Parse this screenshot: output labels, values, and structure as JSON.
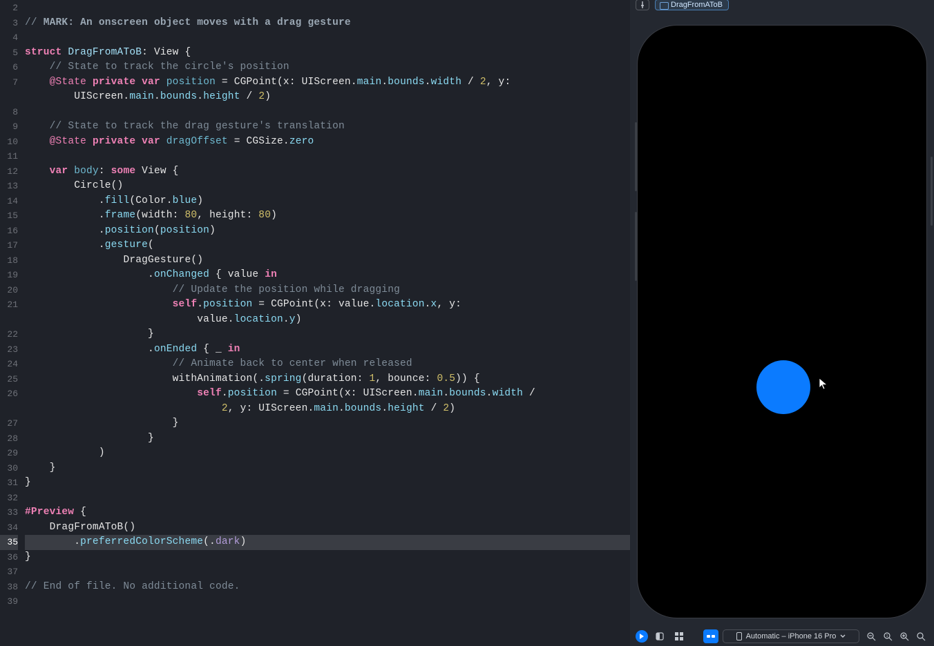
{
  "preview": {
    "breadcrumb_label": "DragFromAToB",
    "device_selector": "Automatic – iPhone 16 Pro"
  },
  "editor": {
    "active_line": 35,
    "lines": [
      {
        "n": 2,
        "html": ""
      },
      {
        "n": 3,
        "html": "<span class='cmt'>// </span><span class='cmt-bold'>MARK: An onscreen object moves with a drag gesture</span>"
      },
      {
        "n": 4,
        "html": ""
      },
      {
        "n": 5,
        "html": "<span class='kw-pink'>struct</span> <span class='type-blue'>DragFromAToB</span><span class='white'>: View {</span>"
      },
      {
        "n": 6,
        "html": "    <span class='cmt'>// State to track the circle's position</span>"
      },
      {
        "n": 7,
        "html": "    <span class='kw-pink2'>@State</span> <span class='kw-pink'>private</span> <span class='kw-pink'>var</span> <span class='identifier'>position</span> <span class='white'>= CGPoint(x: UIScreen.</span><span class='prop'>main</span><span class='white'>.</span><span class='prop'>bounds</span><span class='white'>.</span><span class='prop'>width</span> <span class='white'>/</span> <span class='num'>2</span><span class='white'>, y:</span>"
      },
      {
        "n": "",
        "html": "        <span class='white'>UIScreen.</span><span class='prop'>main</span><span class='white'>.</span><span class='prop'>bounds</span><span class='white'>.</span><span class='prop'>height</span> <span class='white'>/</span> <span class='num'>2</span><span class='white'>)</span>"
      },
      {
        "n": 8,
        "html": ""
      },
      {
        "n": 9,
        "html": "    <span class='cmt'>// State to track the drag gesture's translation</span>"
      },
      {
        "n": 10,
        "html": "    <span class='kw-pink2'>@State</span> <span class='kw-pink'>private</span> <span class='kw-pink'>var</span> <span class='identifier'>dragOffset</span> <span class='white'>= CGSize.</span><span class='prop'>zero</span>"
      },
      {
        "n": 11,
        "html": ""
      },
      {
        "n": 12,
        "html": "    <span class='kw-pink'>var</span> <span class='identifier'>body</span><span class='white'>:</span> <span class='kw-pink'>some</span> <span class='white'>View {</span>"
      },
      {
        "n": 13,
        "html": "        <span class='white'>Circle()</span>"
      },
      {
        "n": 14,
        "html": "            <span class='white'>.</span><span class='call'>fill</span><span class='white'>(Color.</span><span class='prop'>blue</span><span class='white'>)</span>"
      },
      {
        "n": 15,
        "html": "            <span class='white'>.</span><span class='call'>frame</span><span class='white'>(width: </span><span class='num'>80</span><span class='white'>, height: </span><span class='num'>80</span><span class='white'>)</span>"
      },
      {
        "n": 16,
        "html": "            <span class='white'>.</span><span class='call'>position</span><span class='white'>(</span><span class='prop'>position</span><span class='white'>)</span>"
      },
      {
        "n": 17,
        "html": "            <span class='white'>.</span><span class='call'>gesture</span><span class='white'>(</span>"
      },
      {
        "n": 18,
        "html": "                <span class='white'>DragGesture()</span>"
      },
      {
        "n": 19,
        "html": "                    <span class='white'>.</span><span class='call'>onChanged</span> <span class='white'>{ value </span><span class='kw-pink'>in</span>"
      },
      {
        "n": 20,
        "html": "                        <span class='cmt'>// Update the position while dragging</span>"
      },
      {
        "n": 21,
        "html": "                        <span class='kw-pink'>self</span><span class='white'>.</span><span class='prop'>position</span> <span class='white'>= CGPoint(x: value.</span><span class='prop'>location</span><span class='white'>.</span><span class='prop'>x</span><span class='white'>, y:</span>"
      },
      {
        "n": "",
        "html": "                            <span class='white'>value.</span><span class='prop'>location</span><span class='white'>.</span><span class='prop'>y</span><span class='white'>)</span>"
      },
      {
        "n": 22,
        "html": "                    <span class='white'>}</span>"
      },
      {
        "n": 23,
        "html": "                    <span class='white'>.</span><span class='call'>onEnded</span> <span class='white'>{ _ </span><span class='kw-pink'>in</span>"
      },
      {
        "n": 24,
        "html": "                        <span class='cmt'>// Animate back to center when released</span>"
      },
      {
        "n": 25,
        "html": "                        <span class='white'>withAnimation(.</span><span class='call'>spring</span><span class='white'>(duration: </span><span class='num'>1</span><span class='white'>, bounce: </span><span class='num'>0.5</span><span class='white'>)) {</span>"
      },
      {
        "n": 26,
        "html": "                            <span class='kw-pink'>self</span><span class='white'>.</span><span class='prop'>position</span> <span class='white'>= CGPoint(x: UIScreen.</span><span class='prop'>main</span><span class='white'>.</span><span class='prop'>bounds</span><span class='white'>.</span><span class='prop'>width</span> <span class='white'>/</span>"
      },
      {
        "n": "",
        "html": "                                <span class='num'>2</span><span class='white'>, y: UIScreen.</span><span class='prop'>main</span><span class='white'>.</span><span class='prop'>bounds</span><span class='white'>.</span><span class='prop'>height</span> <span class='white'>/</span> <span class='num'>2</span><span class='white'>)</span>"
      },
      {
        "n": 27,
        "html": "                        <span class='white'>}</span>"
      },
      {
        "n": 28,
        "html": "                    <span class='white'>}</span>"
      },
      {
        "n": 29,
        "html": "            <span class='white'>)</span>"
      },
      {
        "n": 30,
        "html": "    <span class='white'>}</span>"
      },
      {
        "n": 31,
        "html": "<span class='white'>}</span>"
      },
      {
        "n": 32,
        "html": ""
      },
      {
        "n": 33,
        "html": "<span class='kw-pink'>#Preview</span> <span class='white'>{</span>"
      },
      {
        "n": 34,
        "html": "    <span class='white'>DragFromAToB()</span>"
      },
      {
        "n": 35,
        "html": "        <span class='white'>.</span><span class='call'>preferredColorScheme</span><span class='white'>(.</span><span class='enumcase'>dark</span><span class='white'>)</span>",
        "hl": true
      },
      {
        "n": 36,
        "html": "<span class='white'>}</span>"
      },
      {
        "n": 37,
        "html": ""
      },
      {
        "n": 38,
        "html": "<span class='cmt'>// End of file. No additional code.</span>"
      },
      {
        "n": 39,
        "html": ""
      }
    ]
  }
}
